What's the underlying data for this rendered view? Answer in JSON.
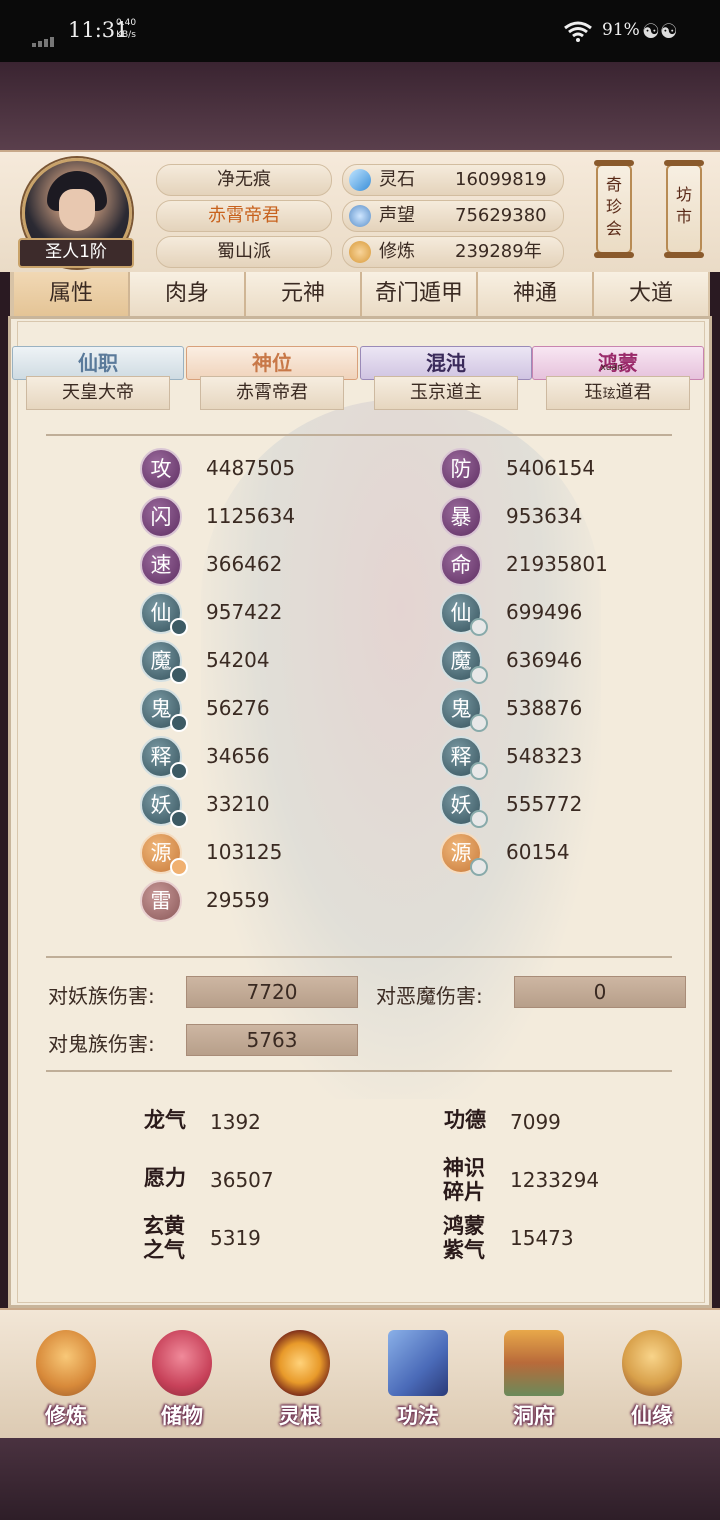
{
  "status_bar": {
    "time": "11:31",
    "net_speed": "0.40",
    "net_unit": "KB/s",
    "battery": "91%"
  },
  "player": {
    "rank": "圣人1阶",
    "name": "净无痕",
    "title": "赤霄帝君",
    "sect": "蜀山派"
  },
  "resources": [
    {
      "label": "灵石",
      "value": "16099819",
      "icon": "spirit-stone-icon",
      "color": "#3a8fd8"
    },
    {
      "label": "声望",
      "value": "75629380",
      "icon": "prestige-icon",
      "color": "#6a9fd0"
    },
    {
      "label": "修炼",
      "value": "239289年",
      "icon": "meditation-icon",
      "color": "#d89a3a"
    }
  ],
  "side_buttons": {
    "treasure": "奇珍会",
    "market": "坊市"
  },
  "tabs": [
    "属性",
    "肉身",
    "元神",
    "奇门遁甲",
    "神通",
    "大道"
  ],
  "active_tab": "属性",
  "titles": [
    {
      "cap": "仙职",
      "value": "天皇大帝",
      "color": "#5a7a9a"
    },
    {
      "cap": "神位",
      "value": "赤霄帝君",
      "color": "#c87848"
    },
    {
      "cap": "混沌",
      "value": "玉京道主",
      "color": "#4a3a6a"
    },
    {
      "cap": "鸿蒙",
      "value": "珏",
      "ruby": "xuán",
      "ruby_char": "玹",
      "suffix": "道君",
      "color": "#9a3a7a"
    }
  ],
  "stats_left": [
    {
      "label": "攻",
      "value": "4487505"
    },
    {
      "label": "闪",
      "value": "1125634"
    },
    {
      "label": "速",
      "value": "366462"
    },
    {
      "label": "仙",
      "value": "957422"
    },
    {
      "label": "魔",
      "value": "54204"
    },
    {
      "label": "鬼",
      "value": "56276"
    },
    {
      "label": "释",
      "value": "34656"
    },
    {
      "label": "妖",
      "value": "33210"
    },
    {
      "label": "源",
      "value": "103125"
    },
    {
      "label": "雷",
      "value": "29559"
    }
  ],
  "stats_right": [
    {
      "label": "防",
      "value": "5406154"
    },
    {
      "label": "暴",
      "value": "953634"
    },
    {
      "label": "命",
      "value": "21935801"
    },
    {
      "label": "仙",
      "value": "699496"
    },
    {
      "label": "魔",
      "value": "636946"
    },
    {
      "label": "鬼",
      "value": "538876"
    },
    {
      "label": "释",
      "value": "548323"
    },
    {
      "label": "妖",
      "value": "555772"
    },
    {
      "label": "源",
      "value": "60154"
    }
  ],
  "damage": {
    "vs_demon_beast_label": "对妖族伤害:",
    "vs_demon_beast": "7720",
    "vs_evil_demon_label": "对恶魔伤害:",
    "vs_evil_demon": "0",
    "vs_ghost_label": "对鬼族伤害:",
    "vs_ghost": "5763"
  },
  "extra": [
    {
      "label": "龙气",
      "value": "1392"
    },
    {
      "label": "功德",
      "value": "7099"
    },
    {
      "label": "愿力",
      "value": "36507"
    },
    {
      "label": "神识碎片",
      "value": "1233294"
    },
    {
      "label": "玄黄之气",
      "value": "5319"
    },
    {
      "label": "鸿蒙紫气",
      "value": "15473"
    }
  ],
  "nav": [
    {
      "label": "修炼",
      "icon": "cultivate-icon",
      "color": "#d88a3a"
    },
    {
      "label": "储物",
      "icon": "storage-bag-icon",
      "color": "#c8425a"
    },
    {
      "label": "灵根",
      "icon": "spirit-root-icon",
      "color": "#e89a2a"
    },
    {
      "label": "功法",
      "icon": "technique-book-icon",
      "color": "#4a6ab8"
    },
    {
      "label": "洞府",
      "icon": "cave-dwelling-icon",
      "color": "#b86a3a"
    },
    {
      "label": "仙缘",
      "icon": "immortal-fate-icon",
      "color": "#d8a04a"
    }
  ]
}
